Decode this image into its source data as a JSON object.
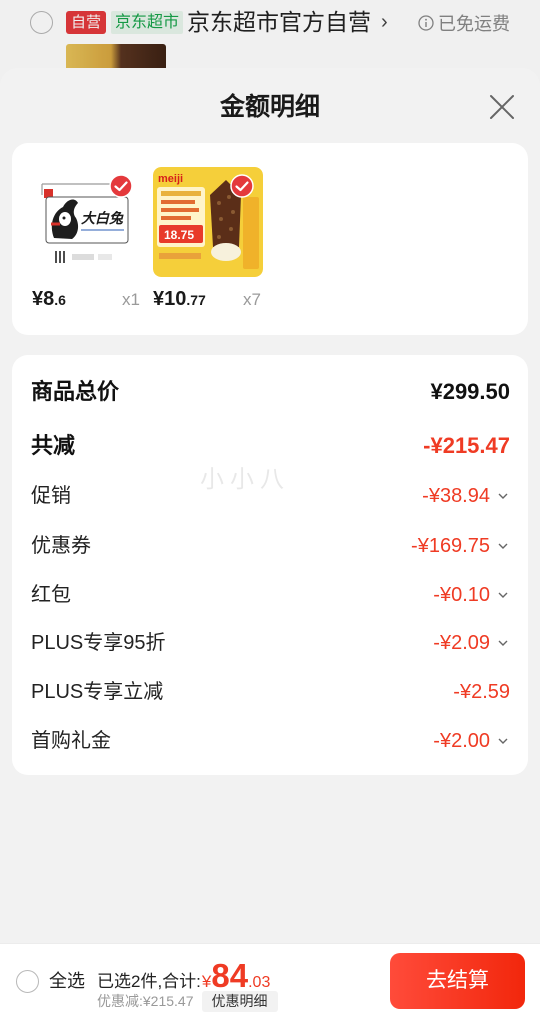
{
  "background_page": {
    "store_badge": "自营",
    "store_tag": "京东超市",
    "store_name": "京东超市官方自营",
    "store_chevron": "›",
    "shipping_icon": "info-icon",
    "shipping_text": "已免运费"
  },
  "sheet": {
    "title": "金额明细",
    "close_icon": "close-icon"
  },
  "products": [
    {
      "image_text": "大白兔",
      "price_int": "¥8",
      "price_dec": ".6",
      "qty": "x1",
      "checked": true
    },
    {
      "image_logo": "meiji",
      "image_price": "18.75",
      "price_int": "¥10",
      "price_dec": ".77",
      "qty": "x7",
      "checked": true
    }
  ],
  "summary": {
    "total": {
      "label": "商品总价",
      "value": "¥299.50"
    },
    "reduction": {
      "label": "共减",
      "value": "-¥215.47"
    },
    "items": [
      {
        "label": "促销",
        "value": "-¥38.94",
        "expandable": true
      },
      {
        "label": "优惠券",
        "value": "-¥169.75",
        "expandable": true
      },
      {
        "label": "红包",
        "value": "-¥0.10",
        "expandable": true
      },
      {
        "label": "PLUS专享95折",
        "value": "-¥2.09",
        "expandable": true
      },
      {
        "label": "PLUS专享立减",
        "value": "-¥2.59",
        "expandable": false
      },
      {
        "label": "首购礼金",
        "value": "-¥2.00",
        "expandable": true
      }
    ]
  },
  "watermark": "小小八",
  "footer": {
    "select_all": "全选",
    "selected_text": "已选2件,合计:",
    "total_symbol": "¥",
    "total_int": "84",
    "total_dec": ".03",
    "discount_text": "优惠减:¥215.47",
    "detail_tag": "优惠明细",
    "checkout": "去结算"
  },
  "colors": {
    "accent_red": "#ef3b24",
    "brand_red": "#e4393c",
    "market_green": "#17a34a",
    "sheet_bg": "#f2f2f2"
  }
}
